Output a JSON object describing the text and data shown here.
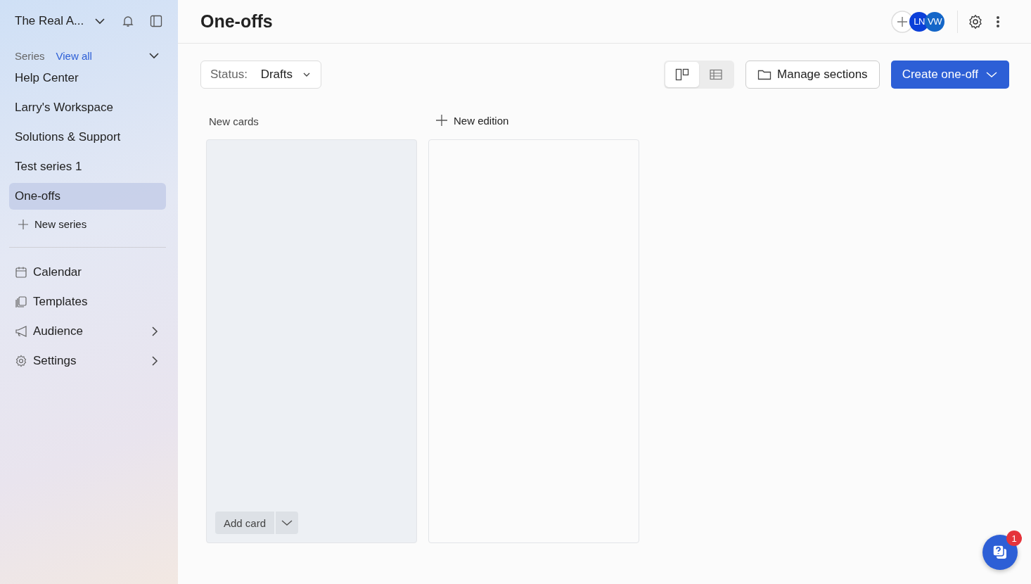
{
  "sidebar": {
    "workspace": "The Real A...",
    "series_label": "Series",
    "view_all": "View all",
    "series": [
      {
        "label": "Help Center",
        "selected": false
      },
      {
        "label": "Larry's Workspace",
        "selected": false
      },
      {
        "label": "Solutions & Support",
        "selected": false
      },
      {
        "label": "Test series 1",
        "selected": false
      },
      {
        "label": "One-offs",
        "selected": true
      }
    ],
    "new_series": "New series",
    "nav": [
      {
        "label": "Calendar",
        "kind": "calendar",
        "expandable": false
      },
      {
        "label": "Templates",
        "kind": "templates",
        "expandable": false
      },
      {
        "label": "Audience",
        "kind": "audience",
        "expandable": true
      },
      {
        "label": "Settings",
        "kind": "settings",
        "expandable": true
      }
    ]
  },
  "header": {
    "title": "One-offs",
    "avatars": [
      {
        "initials": "LN",
        "color": "#0b3fd9"
      },
      {
        "initials": "VW",
        "color": "#1466c8"
      }
    ]
  },
  "toolbar": {
    "filter_label": "Status:",
    "filter_value": "Drafts",
    "views": [
      {
        "kind": "board",
        "selected": true
      },
      {
        "kind": "table",
        "selected": false
      }
    ],
    "manage": "Manage sections",
    "create": "Create one-off"
  },
  "columns": [
    {
      "kind": "section",
      "title": "New cards",
      "add_button": "Add card"
    },
    {
      "kind": "new",
      "title": "New edition"
    }
  ],
  "help": {
    "badge": "1"
  }
}
